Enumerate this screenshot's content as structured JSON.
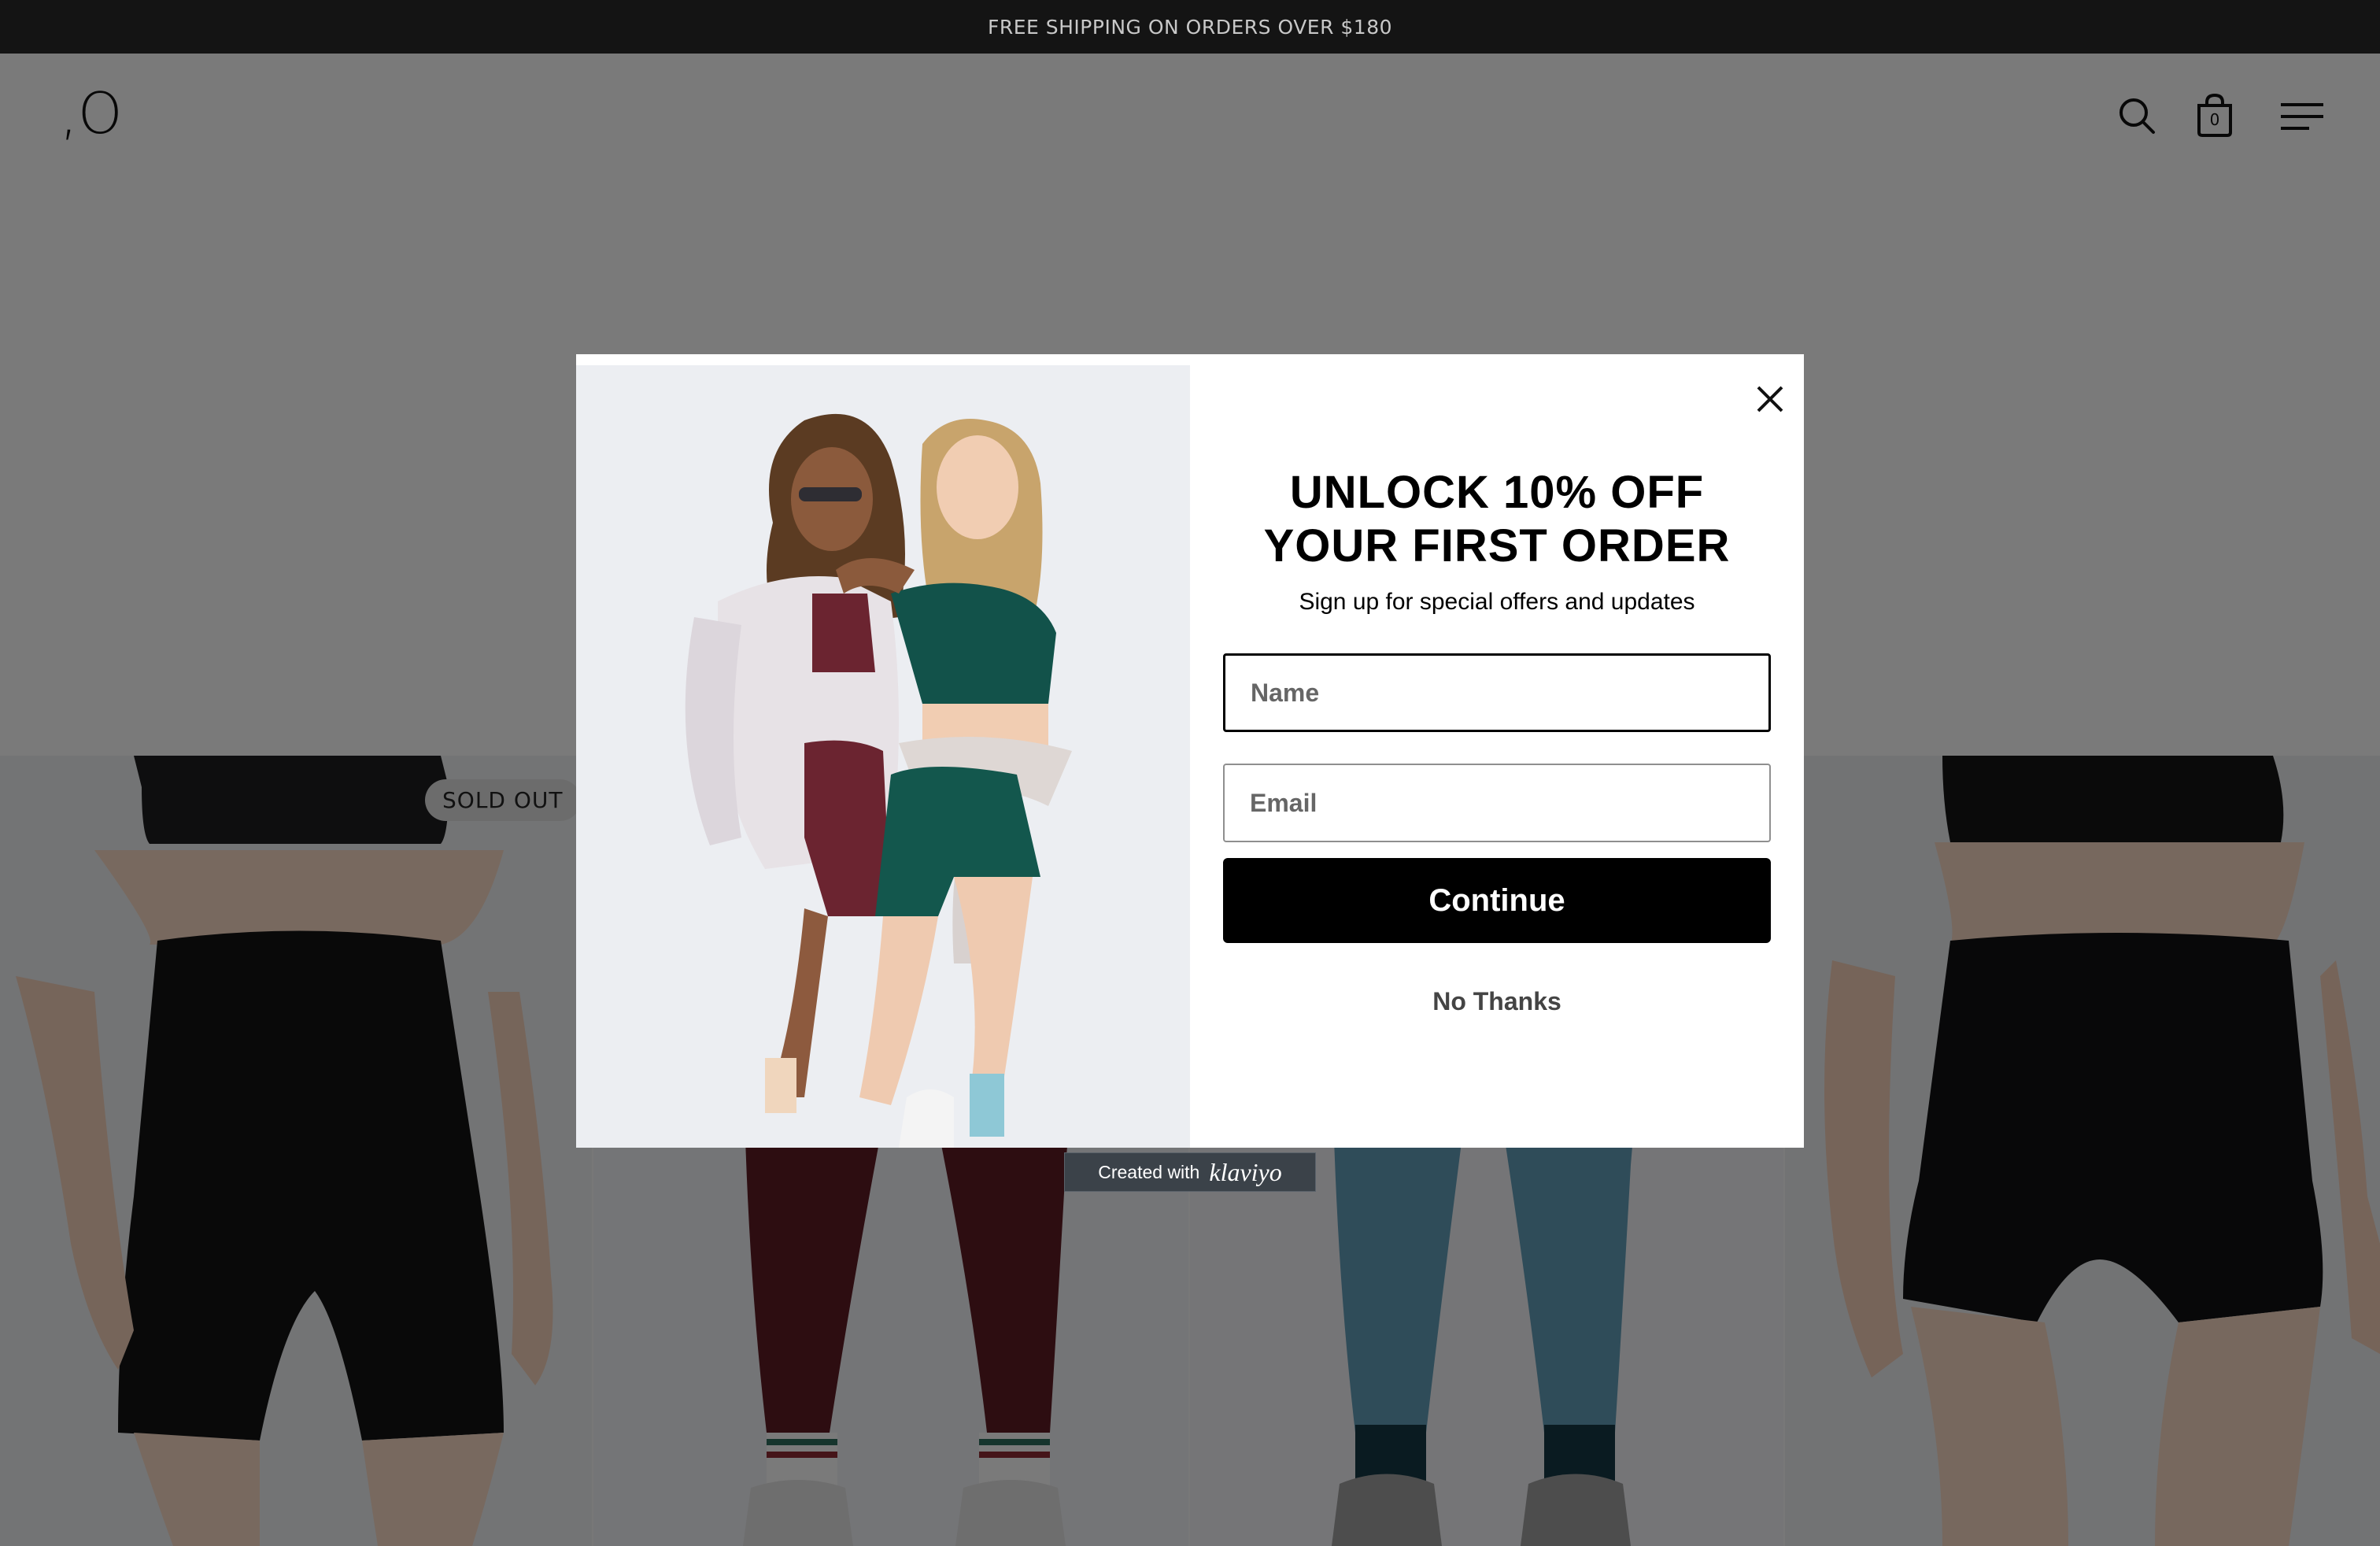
{
  "announcement": {
    "text": "FREE SHIPPING ON ORDERS OVER $180"
  },
  "header": {
    "logo": ",O",
    "cart_count": "0",
    "icons": [
      "search-icon",
      "cart-icon",
      "menu-icon"
    ]
  },
  "products": [
    {
      "badge": "SOLD OUT",
      "color_name": "black"
    },
    {
      "color_name": "burgundy"
    },
    {
      "color_name": "light-blue"
    },
    {
      "color_name": "black"
    }
  ],
  "popup": {
    "headline_line1": "UNLOCK 10% OFF",
    "headline_line2": "YOUR FIRST ORDER",
    "subtitle": "Sign up for special offers and updates",
    "name_placeholder": "Name",
    "email_placeholder": "Email",
    "continue_label": "Continue",
    "no_thanks_label": "No Thanks",
    "powered_by_prefix": "Created with",
    "powered_by_brand": "klaviyo"
  },
  "colors": {
    "overlay": "#00000080",
    "button": "#000000",
    "announcement_bg": "#141414"
  }
}
